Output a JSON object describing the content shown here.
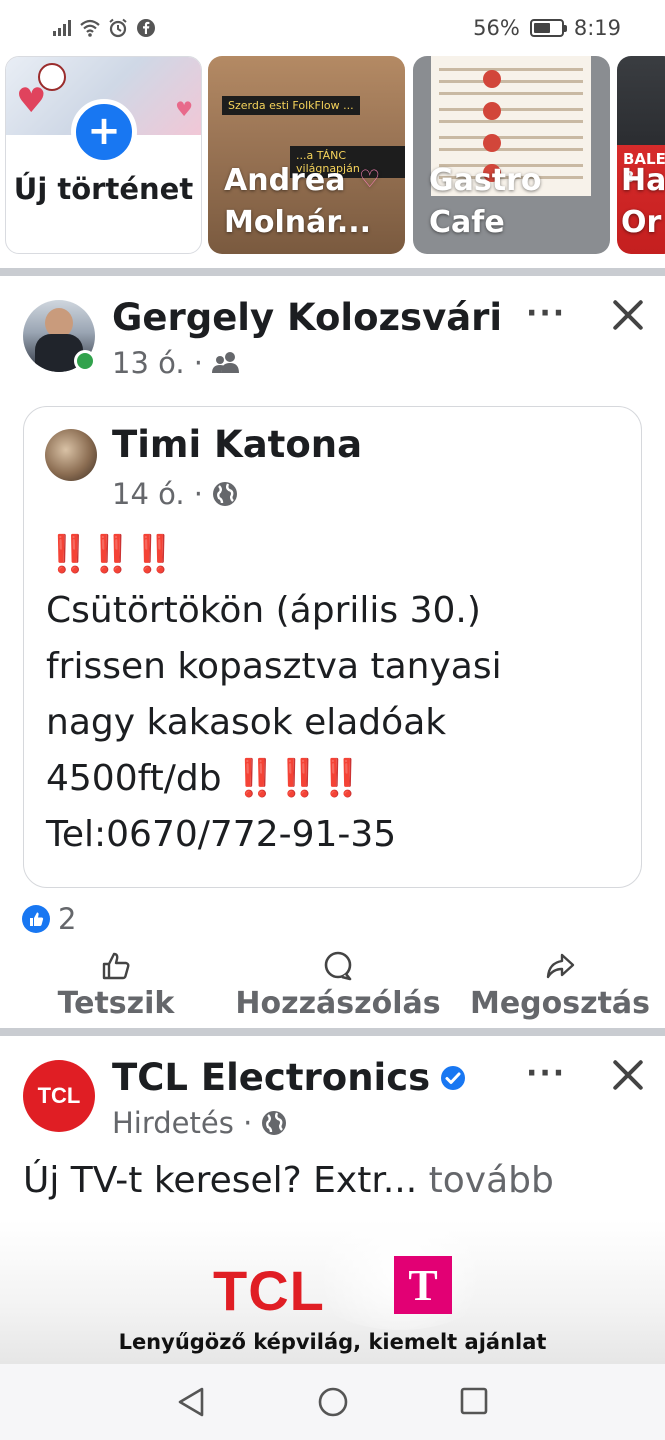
{
  "status_bar": {
    "battery_percent": "56%",
    "battery_level": 0.56,
    "time": "8:19"
  },
  "stories": {
    "new_story_label": "Új történet",
    "items": [
      {
        "label": "Andrea Molnár...",
        "banner_top": "Szerda esti FolkFlow ...",
        "banner_bottom": "...a TÁNC világnapján"
      },
      {
        "label": "Gastro Cafe"
      },
      {
        "label": "Ha Or",
        "banner": "BALESE B"
      }
    ]
  },
  "post": {
    "author": "Gergely Kolozsvári",
    "time": "13 ó. ·",
    "audience_icon": "friends-icon",
    "shared": {
      "author": "Timi Katona",
      "time": "14 ó. ·",
      "audience_icon": "globe-icon",
      "bangs_top": "‼️‼️‼️",
      "line1": "Csütörtökön (április 30.)",
      "line2": "frissen kopasztva tanyasi",
      "line3": "nagy kakasok eladóak",
      "line4_prefix": "4500ft/db",
      "bangs_inline": "‼️‼️‼️",
      "line5": "Tel:0670/772-91-35"
    },
    "reaction_count": "2",
    "actions": {
      "like": "Tetszik",
      "comment": "Hozzászólás",
      "share": "Megosztás"
    }
  },
  "ad": {
    "author": "TCL Electronics",
    "logo_text": "TCL",
    "meta": "Hirdetés ·",
    "text": "Új TV-t keresel? Extr...",
    "more": "tovább",
    "image_brand": "TCL",
    "image_partner": "T",
    "tagline": "Lenyűgöző képvilág, kiemelt ajánlat"
  },
  "colors": {
    "accent": "#1877f2",
    "text": "#1c1e21",
    "secondary": "#65676b",
    "tcl_red": "#e01e24",
    "tmobile_magenta": "#e20074",
    "bang_red": "#e0202b",
    "online_green": "#31a24c"
  }
}
